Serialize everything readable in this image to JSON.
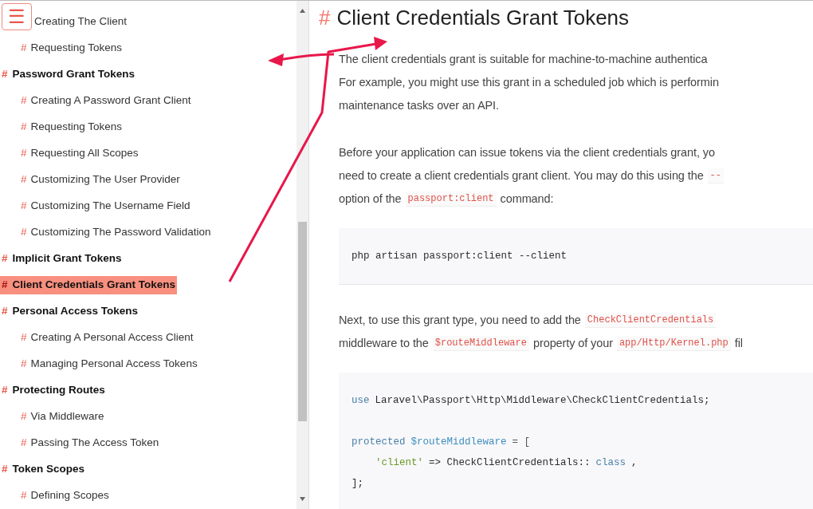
{
  "menu_button": {
    "glyph": "☰"
  },
  "sidebar": {
    "sections": [
      {
        "children": [
          {
            "label": "Creating The Client",
            "selected": false
          },
          {
            "hash": "#",
            "label": "Requesting Tokens",
            "selected": false
          }
        ]
      },
      {
        "hash": "#",
        "label": "Password Grant Tokens",
        "selected": false,
        "children": [
          {
            "hash": "#",
            "label": "Creating A Password Grant Client",
            "selected": false
          },
          {
            "hash": "#",
            "label": "Requesting Tokens",
            "selected": false
          },
          {
            "hash": "#",
            "label": "Requesting All Scopes",
            "selected": false
          },
          {
            "hash": "#",
            "label": "Customizing The User Provider",
            "selected": false
          },
          {
            "hash": "#",
            "label": "Customizing The Username Field",
            "selected": false
          },
          {
            "hash": "#",
            "label": "Customizing The Password Validation",
            "selected": false
          }
        ]
      },
      {
        "hash": "#",
        "label": "Implicit Grant Tokens",
        "selected": false
      },
      {
        "hash": "#",
        "label": "Client Credentials Grant Tokens",
        "selected": true
      },
      {
        "hash": "#",
        "label": "Personal Access Tokens",
        "selected": false,
        "children": [
          {
            "hash": "#",
            "label": "Creating A Personal Access Client",
            "selected": false
          },
          {
            "hash": "#",
            "label": "Managing Personal Access Tokens",
            "selected": false
          }
        ]
      },
      {
        "hash": "#",
        "label": "Protecting Routes",
        "selected": false,
        "children": [
          {
            "hash": "#",
            "label": "Via Middleware",
            "selected": false
          },
          {
            "hash": "#",
            "label": "Passing The Access Token",
            "selected": false
          }
        ]
      },
      {
        "hash": "#",
        "label": "Token Scopes",
        "selected": false,
        "children": [
          {
            "hash": "#",
            "label": "Defining Scopes",
            "selected": false
          }
        ]
      }
    ]
  },
  "content": {
    "heading": {
      "hash": "#",
      "title": "Client Credentials Grant Tokens"
    },
    "blocks": [
      {
        "kind": "paragraph",
        "lines": [
          [
            {
              "kind": "text",
              "text": "The client credentials grant is suitable for machine-to-machine authentica"
            }
          ],
          [
            {
              "kind": "text",
              "text": "For example, you might use this grant in a scheduled job which is performin"
            }
          ],
          [
            {
              "kind": "text",
              "text": "maintenance tasks over an API."
            }
          ]
        ]
      },
      {
        "kind": "paragraph",
        "lines": [
          [
            {
              "kind": "text",
              "text": "Before your application can issue tokens via the client credentials grant, yo"
            }
          ],
          [
            {
              "kind": "text",
              "text": "need to create a client credentials grant client. You may do this using the"
            },
            {
              "kind": "code",
              "text": "--"
            }
          ],
          [
            {
              "kind": "text",
              "text": "option of the"
            },
            {
              "kind": "code",
              "text": "passport:client"
            },
            {
              "kind": "text",
              "text": "command:"
            }
          ]
        ]
      },
      {
        "kind": "code_block",
        "lines": [
          [
            {
              "kind": "plain",
              "text": "php artisan passport:client --client"
            }
          ]
        ]
      },
      {
        "kind": "paragraph",
        "lines": [
          [
            {
              "kind": "text",
              "text": "Next, to use this grant type, you need to add the"
            },
            {
              "kind": "code",
              "text": "CheckClientCredentials"
            }
          ],
          [
            {
              "kind": "text",
              "text": "middleware to the"
            },
            {
              "kind": "code",
              "text": "$routeMiddleware"
            },
            {
              "kind": "text",
              "text": "property of your"
            },
            {
              "kind": "code",
              "text": "app/Http/Kernel.php"
            },
            {
              "kind": "text",
              "text": "fil"
            }
          ]
        ]
      },
      {
        "kind": "code_block",
        "lines": [
          [
            {
              "kind": "keyword",
              "text": "use"
            },
            {
              "kind": "plain",
              "text": "Laravel\\Passport\\Http\\Middleware\\CheckClientCredentials;"
            }
          ],
          [
            {
              "kind": "keyword",
              "text": "protected"
            },
            {
              "kind": "variable",
              "text": "$routeMiddleware"
            },
            {
              "kind": "operator",
              "text": "= ["
            }
          ],
          [
            {
              "kind": "string",
              "text": "    'client'"
            },
            {
              "kind": "plain",
              "text": "=> CheckClientCredentials::"
            },
            {
              "kind": "keyword",
              "text": "class"
            },
            {
              "kind": "plain",
              "text": ","
            }
          ],
          [
            {
              "kind": "plain",
              "text": "];"
            }
          ]
        ]
      }
    ]
  }
}
